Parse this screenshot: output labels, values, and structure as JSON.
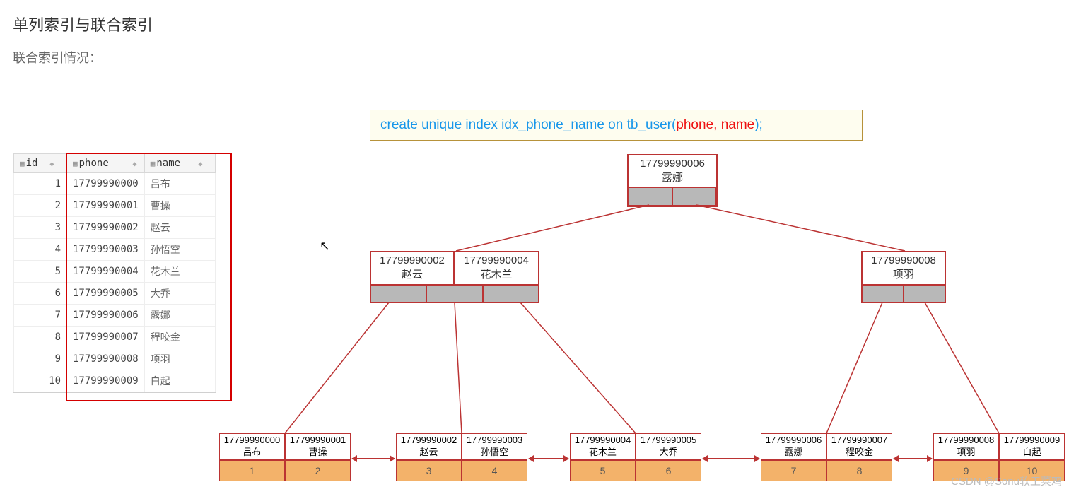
{
  "title": "单列索引与联合索引",
  "subtitle": "联合索引情况：",
  "table": {
    "headers": {
      "id": "id",
      "phone": "phone",
      "name": "name"
    },
    "rows": [
      {
        "id": "1",
        "phone": "17799990000",
        "name": "吕布"
      },
      {
        "id": "2",
        "phone": "17799990001",
        "name": "曹操"
      },
      {
        "id": "3",
        "phone": "17799990002",
        "name": "赵云"
      },
      {
        "id": "4",
        "phone": "17799990003",
        "name": "孙悟空"
      },
      {
        "id": "5",
        "phone": "17799990004",
        "name": "花木兰"
      },
      {
        "id": "6",
        "phone": "17799990005",
        "name": "大乔"
      },
      {
        "id": "7",
        "phone": "17799990006",
        "name": "露娜"
      },
      {
        "id": "8",
        "phone": "17799990007",
        "name": "程咬金"
      },
      {
        "id": "9",
        "phone": "17799990008",
        "name": "项羽"
      },
      {
        "id": "10",
        "phone": "17799990009",
        "name": "白起"
      }
    ]
  },
  "sql": {
    "prefix": "create unique index idx_phone_name on tb_user(",
    "cols": "phone, name",
    "suffix": ");"
  },
  "root": {
    "phone": "17799990006",
    "name": "露娜"
  },
  "inner": {
    "left": [
      {
        "phone": "17799990002",
        "name": "赵云"
      },
      {
        "phone": "17799990004",
        "name": "花木兰"
      }
    ],
    "right": [
      {
        "phone": "17799990008",
        "name": "项羽"
      }
    ]
  },
  "leaves": [
    [
      {
        "phone": "17799990000",
        "name": "吕布",
        "id": "1"
      },
      {
        "phone": "17799990001",
        "name": "曹操",
        "id": "2"
      }
    ],
    [
      {
        "phone": "17799990002",
        "name": "赵云",
        "id": "3"
      },
      {
        "phone": "17799990003",
        "name": "孙悟空",
        "id": "4"
      }
    ],
    [
      {
        "phone": "17799990004",
        "name": "花木兰",
        "id": "5"
      },
      {
        "phone": "17799990005",
        "name": "大乔",
        "id": "6"
      }
    ],
    [
      {
        "phone": "17799990006",
        "name": "露娜",
        "id": "7"
      },
      {
        "phone": "17799990007",
        "name": "程咬金",
        "id": "8"
      }
    ],
    [
      {
        "phone": "17799990008",
        "name": "项羽",
        "id": "9"
      },
      {
        "phone": "17799990009",
        "name": "白起",
        "id": "10"
      }
    ]
  ],
  "watermark": "CSDN @Sonu软工菜鸡"
}
